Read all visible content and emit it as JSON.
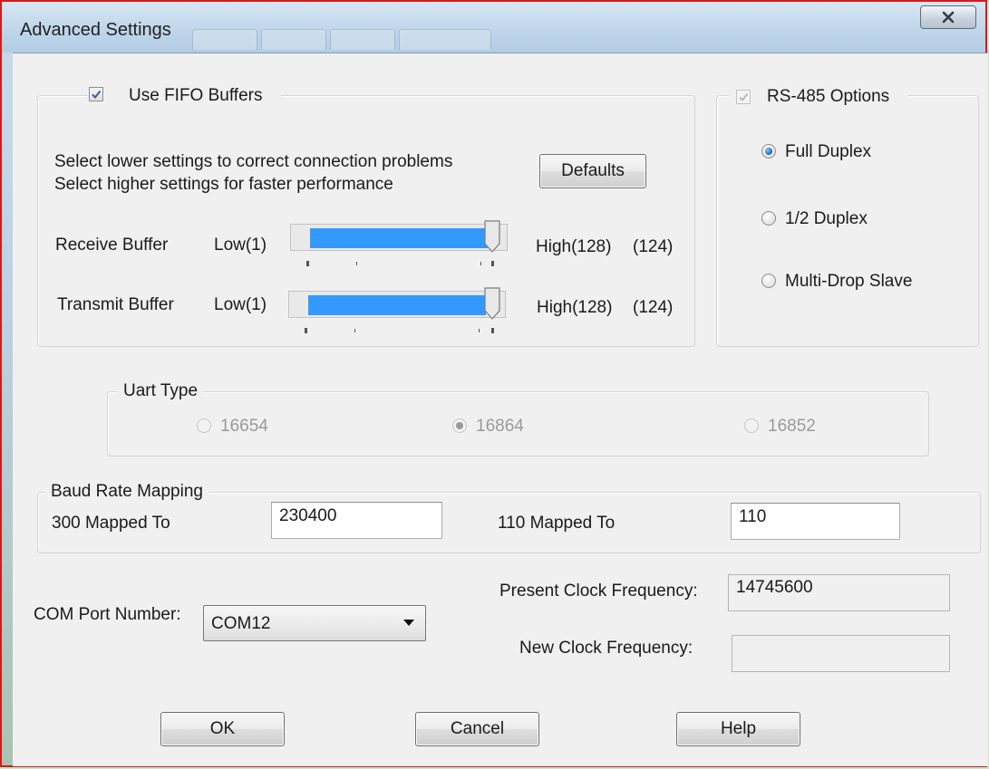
{
  "window": {
    "title": "Advanced Settings"
  },
  "fifo": {
    "checkbox_label": "Use FIFO Buffers",
    "checked": true,
    "hint_line1": "Select lower settings to correct connection problems",
    "hint_line2": "Select higher settings for faster performance",
    "defaults_label": "Defaults",
    "receive": {
      "label": "Receive Buffer",
      "low": "Low(1)",
      "high": "High(128)",
      "value_text": "(124)",
      "value": 124
    },
    "transmit": {
      "label": "Transmit Buffer",
      "low": "Low(1)",
      "high": "High(128)",
      "value_text": "(124)",
      "value": 124
    }
  },
  "rs485": {
    "label": "RS-485 Options",
    "checked": true,
    "disabled": true,
    "options": [
      "Full Duplex",
      "1/2 Duplex",
      "Multi-Drop Slave"
    ],
    "selected": "Full Duplex"
  },
  "uart": {
    "label": "Uart Type",
    "disabled": true,
    "options": [
      "16654",
      "16864",
      "16852"
    ],
    "selected": "16864"
  },
  "baud": {
    "label": "Baud Rate Mapping",
    "map1_label": "300 Mapped To",
    "map1_value": "230400",
    "map2_label": "110 Mapped To",
    "map2_value": "110"
  },
  "com": {
    "label": "COM Port Number:",
    "value": "COM12"
  },
  "clock": {
    "present_label": "Present Clock Frequency:",
    "present_value": "14745600",
    "new_label": "New Clock Frequency:",
    "new_value": ""
  },
  "buttons": {
    "ok": "OK",
    "cancel": "Cancel",
    "help": "Help"
  },
  "colors": {
    "slider_fill": "#3399ff",
    "window_border": "#d21b1b",
    "radio_selected": "#1e6fcf"
  }
}
